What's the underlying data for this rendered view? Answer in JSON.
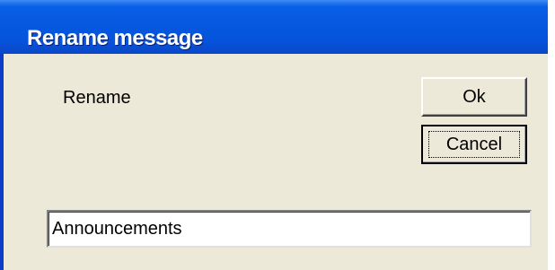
{
  "window": {
    "title": "Rename message"
  },
  "dialog": {
    "prompt": "Rename",
    "ok_label": "Ok",
    "cancel_label": "Cancel",
    "name_value": "Announcements"
  },
  "colors": {
    "titlebar": "#0558df",
    "dialog_bg": "#ece9d8",
    "title_text": "#ffffff"
  }
}
